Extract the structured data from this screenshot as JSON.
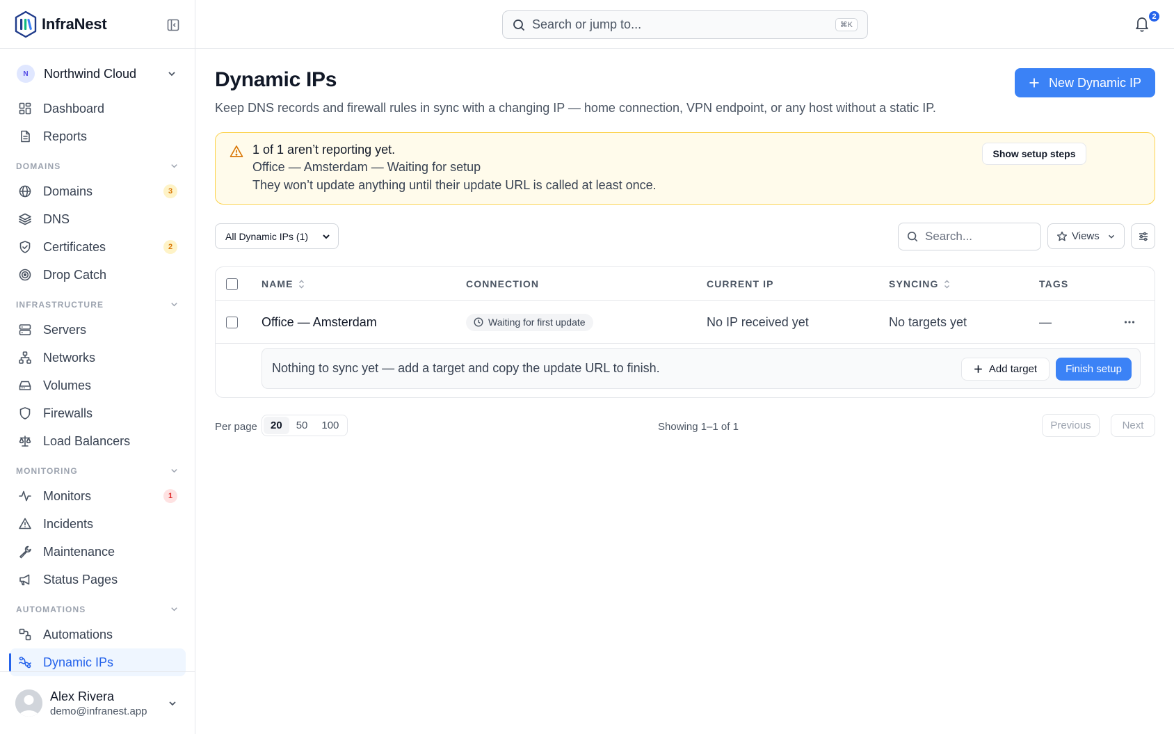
{
  "app": {
    "name": "InfraNest"
  },
  "org": {
    "initial": "N",
    "name": "Northwind Cloud"
  },
  "sidebar": {
    "top_items": [
      {
        "label": "Dashboard",
        "icon": "dashboard-icon"
      },
      {
        "label": "Reports",
        "icon": "reports-icon"
      }
    ],
    "sections": [
      {
        "title": "DOMAINS",
        "items": [
          {
            "label": "Domains",
            "icon": "globe-icon",
            "count": "3",
            "count_color": "#d97706"
          },
          {
            "label": "DNS",
            "icon": "layers-icon"
          },
          {
            "label": "Certificates",
            "icon": "shield-check-icon",
            "count": "2",
            "count_color": "#d97706"
          },
          {
            "label": "Drop Catch",
            "icon": "target-icon"
          }
        ]
      },
      {
        "title": "INFRASTRUCTURE",
        "items": [
          {
            "label": "Servers",
            "icon": "server-icon"
          },
          {
            "label": "Networks",
            "icon": "network-icon"
          },
          {
            "label": "Volumes",
            "icon": "volume-icon"
          },
          {
            "label": "Firewalls",
            "icon": "shield-icon"
          },
          {
            "label": "Load Balancers",
            "icon": "scale-icon"
          }
        ]
      },
      {
        "title": "MONITORING",
        "items": [
          {
            "label": "Monitors",
            "icon": "activity-icon",
            "count": "1",
            "count_color": "#dc2626"
          },
          {
            "label": "Incidents",
            "icon": "alert-triangle-icon"
          },
          {
            "label": "Maintenance",
            "icon": "wrench-icon"
          },
          {
            "label": "Status Pages",
            "icon": "megaphone-icon"
          }
        ]
      },
      {
        "title": "AUTOMATIONS",
        "items": [
          {
            "label": "Automations",
            "icon": "workflow-icon"
          },
          {
            "label": "Dynamic IPs",
            "icon": "dynamic-ip-icon",
            "active": true
          }
        ]
      }
    ]
  },
  "user": {
    "name": "Alex Rivera",
    "email": "demo@infranest.app"
  },
  "topbar": {
    "search_placeholder": "Search or jump to...",
    "shortcut": "⌘K",
    "notifications": "2"
  },
  "page": {
    "title": "Dynamic IPs",
    "subtitle": "Keep DNS records and firewall rules in sync with a changing IP — home connection, VPN endpoint, or any host without a static IP.",
    "new_button": "New Dynamic IP"
  },
  "alert": {
    "title": "1 of 1 aren’t reporting yet.",
    "line2": "Office — Amsterdam — Waiting for setup",
    "line3": "They won’t update anything until their update URL is called at least once.",
    "button": "Show setup steps"
  },
  "toolbar": {
    "filter": "All Dynamic IPs (1)",
    "search_placeholder": "Search...",
    "views": "Views"
  },
  "table": {
    "columns": [
      "NAME",
      "CONNECTION",
      "CURRENT IP",
      "SYNCING",
      "TAGS"
    ],
    "rows": [
      {
        "name": "Office — Amsterdam",
        "connection": "Waiting for first update",
        "current_ip": "No IP received yet",
        "syncing": "No targets yet",
        "tags": "—"
      }
    ],
    "hint": "Nothing to sync yet — add a target and copy the update URL to finish.",
    "add_target": "Add target",
    "finish_setup": "Finish setup"
  },
  "pagination": {
    "per_page_label": "Per page",
    "options": [
      "20",
      "50",
      "100"
    ],
    "selected": "20",
    "showing": "Showing 1–1 of 1",
    "previous": "Previous",
    "next": "Next"
  },
  "colors": {
    "accent": "#3b82f6",
    "warning_bg": "#fffbeb",
    "warning_border": "#fcd34d"
  }
}
